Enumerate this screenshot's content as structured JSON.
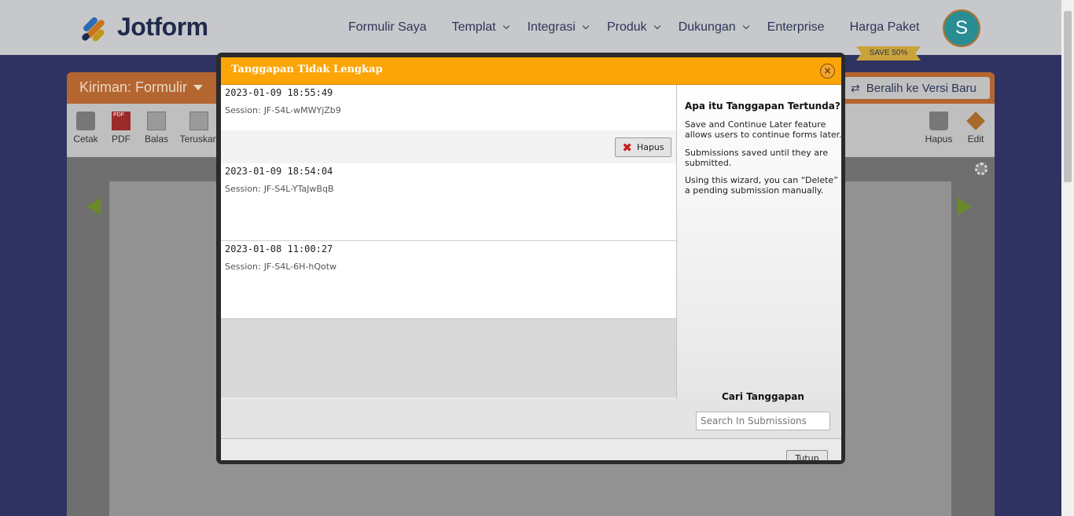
{
  "header": {
    "logo_text": "Jotform",
    "nav": [
      {
        "label": "Formulir Saya"
      },
      {
        "label": "Templat"
      },
      {
        "label": "Integrasi"
      },
      {
        "label": "Produk"
      },
      {
        "label": "Dukungan"
      },
      {
        "label": "Enterprise"
      },
      {
        "label": "Harga Paket"
      }
    ],
    "save_badge": "SAVE 50%",
    "avatar_initial": "S"
  },
  "submissions_page": {
    "title": "Kiriman: Formulir",
    "switch_button": "Beralih ke Versi Baru",
    "toolbar": {
      "print": "Cetak",
      "pdf": "PDF",
      "reply": "Balas",
      "forward": "Teruskan",
      "delete": "Hapus",
      "edit": "Edit"
    },
    "pdf_icon_text": "PDF"
  },
  "modal": {
    "title": "Tanggapan Tidak Lengkap",
    "entries": [
      {
        "date": "2023-01-09 18:55:49",
        "session_label": "Session:",
        "session_id": "JF-S4L-wMWYjZb9"
      },
      {
        "date": "2023-01-09 18:54:04",
        "session_label": "Session:",
        "session_id": "JF-S4L-YTaJwBqB"
      },
      {
        "date": "2023-01-08 11:00:27",
        "session_label": "Session:",
        "session_id": "JF-S4L-6H-hQotw"
      }
    ],
    "delete_button": "Hapus",
    "side_panel": {
      "heading": "Apa itu Tanggapan Tertunda?",
      "para1": "Save and Continue Later feature allows users to continue forms later.",
      "para2": "Submissions saved until they are submitted.",
      "para3": "Using this wizard, you can “Delete” a pending submission manually."
    },
    "search": {
      "heading": "Cari Tanggapan",
      "placeholder": "Search In Submissions"
    },
    "close_button": "Tutup"
  },
  "colors": {
    "modal_header": "#fca507",
    "page_background": "#2f3361",
    "accent_orange": "#b5652f"
  }
}
